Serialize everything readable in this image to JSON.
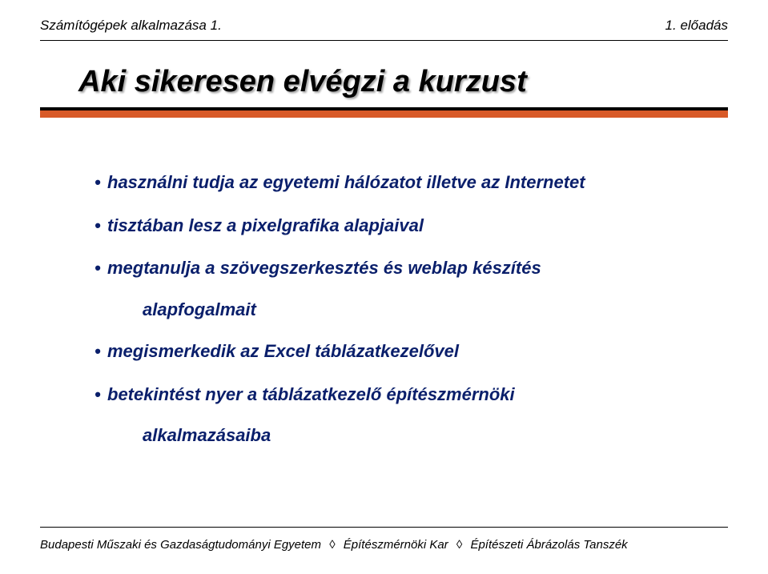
{
  "header": {
    "left": "Számítógépek alkalmazása 1.",
    "right": "1. előadás"
  },
  "title": "Aki sikeresen elvégzi a kurzust",
  "bullets": [
    {
      "text": "használni tudja az egyetemi hálózatot illetve az Internetet"
    },
    {
      "text": "tisztában lesz a pixelgrafika alapjaival"
    },
    {
      "text": "megtanulja a szövegszerkesztés és weblap készítés",
      "sub": "alapfogalmait"
    },
    {
      "text": "megismerkedik az Excel táblázatkezelővel"
    },
    {
      "text": "betekintést nyer a táblázatkezelő építészmérnöki",
      "sub": "alkalmazásaiba"
    }
  ],
  "footer": {
    "p1": "Budapesti Műszaki és Gazdaságtudományi Egyetem",
    "p2": "Építészmérnöki Kar",
    "p3": "Építészeti Ábrázolás Tanszék",
    "sep": "◊"
  }
}
